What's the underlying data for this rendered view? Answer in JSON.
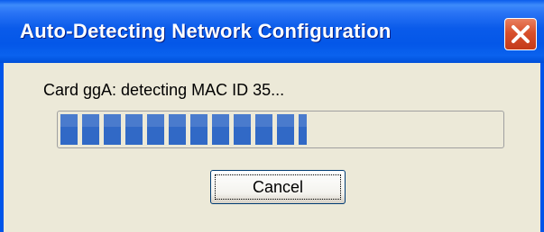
{
  "window": {
    "title": "Auto-Detecting Network Configuration",
    "close_icon": "close-icon"
  },
  "status": {
    "message": "Card ggA: detecting MAC ID 35..."
  },
  "progress": {
    "value_percent": 56,
    "fill_color": "#3169c6"
  },
  "actions": {
    "cancel_label": "Cancel"
  },
  "colors": {
    "titlebar": "#0055ea",
    "close_button": "#d8502c",
    "dialog_background": "#ece9d8"
  }
}
